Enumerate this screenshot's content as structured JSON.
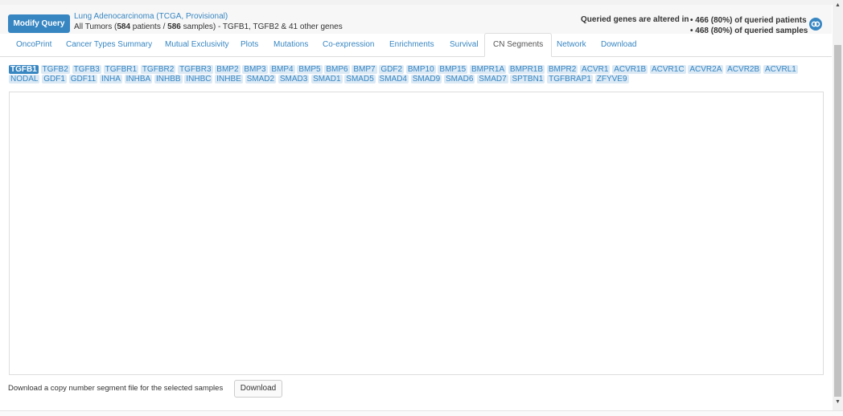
{
  "header": {
    "modify_query_label": "Modify Query",
    "study_name": "Lung Adenocarcinoma (TCGA, Provisional)",
    "summary_prefix": "All Tumors (",
    "patients_count": "584",
    "patients_label": " patients / ",
    "samples_count": "586",
    "samples_label": " samples)",
    "genes_suffix": " - TGFB1, TGFB2 & 41 other genes",
    "altered_label": "Queried genes are altered in",
    "patients_stat": "• 466 (80%) of queried patients",
    "samples_stat": "• 468 (80%) of queried samples",
    "share_icon": "link-icon"
  },
  "tabs": [
    {
      "label": "OncoPrint"
    },
    {
      "label": "Cancer Types Summary"
    },
    {
      "label": "Mutual Exclusivity"
    },
    {
      "label": "Plots"
    },
    {
      "label": "Mutations"
    },
    {
      "label": "Co-expression"
    },
    {
      "label": "Enrichments"
    },
    {
      "label": "Survival"
    },
    {
      "label": "CN Segments"
    },
    {
      "label": "Network"
    },
    {
      "label": "Download"
    }
  ],
  "active_tab": "CN Segments",
  "genes": [
    "TGFB1",
    "TGFB2",
    "TGFB3",
    "TGFBR1",
    "TGFBR2",
    "TGFBR3",
    "BMP2",
    "BMP3",
    "BMP4",
    "BMP5",
    "BMP6",
    "BMP7",
    "GDF2",
    "BMP10",
    "BMP15",
    "BMPR1A",
    "BMPR1B",
    "BMPR2",
    "ACVR1",
    "ACVR1B",
    "ACVR1C",
    "ACVR2A",
    "ACVR2B",
    "ACVRL1",
    "NODAL",
    "GDF1",
    "GDF11",
    "INHA",
    "INHBA",
    "INHBB",
    "INHBC",
    "INHBE",
    "SMAD2",
    "SMAD3",
    "SMAD1",
    "SMAD5",
    "SMAD4",
    "SMAD9",
    "SMAD6",
    "SMAD7",
    "SPTBN1",
    "TGFBRAP1",
    "ZFYVE9"
  ],
  "active_gene": "TGFB1",
  "footer": {
    "download_text": "Download a copy number segment file for the selected samples",
    "download_button": "Download"
  },
  "colors": {
    "accent": "#3786c2",
    "gene_bg": "#dbe9f5"
  }
}
